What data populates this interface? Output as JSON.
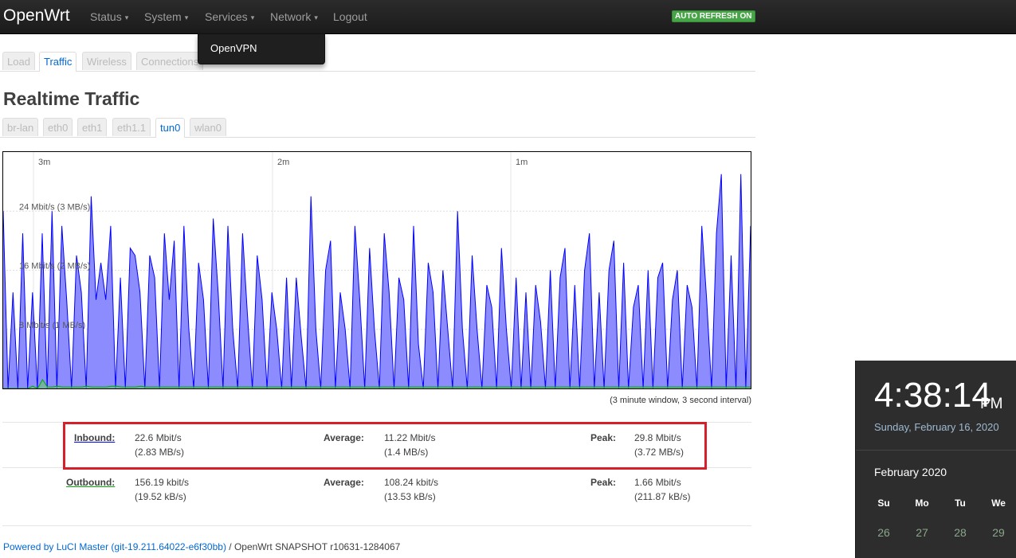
{
  "navbar": {
    "brand": "OpenWrt",
    "menu": [
      "Status",
      "System",
      "Services",
      "Network",
      "Logout"
    ],
    "auto_refresh": "AUTO REFRESH ON",
    "dropdown_item": "OpenVPN"
  },
  "tabs": [
    "Load",
    "Traffic",
    "Wireless",
    "Connections"
  ],
  "active_tab": "Traffic",
  "page_title": "Realtime Traffic",
  "interfaces": [
    "br-lan",
    "eth0",
    "eth1",
    "eth1.1",
    "tun0",
    "wlan0"
  ],
  "active_interface": "tun0",
  "graph": {
    "time_labels": [
      "3m",
      "2m",
      "1m"
    ],
    "y_labels": [
      "24 Mbit/s (3 MB/s)",
      "16 Mbit/s (2 MB/s)",
      "8 Mbit/s (1 MB/s)"
    ],
    "caption": "(3 minute window, 3 second interval)",
    "inbound_color": "#0000ff",
    "inbound_fill": "#8c8cff",
    "outbound_color": "#00aa00"
  },
  "chart_data": {
    "type": "area",
    "y_unit": "Mbit/s",
    "ylim": [
      0,
      32
    ],
    "inbound": [
      24,
      0,
      13,
      0,
      21,
      0,
      13,
      0,
      21,
      0,
      24,
      0,
      22,
      12,
      0,
      18,
      13,
      0,
      26,
      12,
      17,
      12,
      22,
      0,
      15,
      0,
      19,
      18,
      13,
      0,
      18,
      15,
      0,
      21,
      12,
      20,
      0,
      22,
      8,
      0,
      17,
      12,
      0,
      23,
      13,
      0,
      22,
      8,
      0,
      21,
      10,
      0,
      18,
      12,
      0,
      13,
      8,
      0,
      15,
      0,
      15,
      7,
      0,
      26,
      8,
      0,
      16,
      20,
      0,
      13,
      8,
      0,
      22,
      12,
      0,
      19,
      8,
      0,
      21,
      13,
      0,
      15,
      12,
      0,
      22,
      6,
      0,
      17,
      13,
      0,
      16,
      8,
      0,
      24,
      8,
      0,
      18,
      8,
      0,
      14,
      11,
      0,
      19,
      8,
      0,
      15,
      0,
      13,
      0,
      14,
      9,
      0,
      16,
      0,
      15,
      19,
      0,
      14,
      0,
      16,
      21,
      0,
      13,
      0,
      16,
      20,
      0,
      17,
      0,
      11,
      14,
      0,
      16,
      0,
      15,
      17,
      0,
      12,
      16,
      0,
      14,
      11,
      0,
      22,
      12,
      0,
      21,
      29,
      0,
      18,
      0,
      29,
      0,
      22
    ],
    "outbound": [
      0,
      0,
      0,
      0,
      0,
      0,
      0.3,
      0,
      1.2,
      0.2,
      0.2,
      0.3,
      0.2,
      0.2,
      0.2,
      0.2,
      0.2,
      0.3,
      0.2,
      0.2,
      0.2,
      0.2,
      0.3,
      0.3,
      0.2,
      0.2,
      0.2,
      0.2,
      0.3,
      0.2,
      0.2,
      0.2,
      0.2,
      0.2,
      0.2,
      0.2,
      0.2,
      0.2,
      0.2,
      0.2,
      0.2,
      0.2,
      0.2,
      0.2,
      0.2,
      0.2,
      0.2,
      0.2,
      0.2,
      0.2,
      0.2,
      0.2,
      0.2,
      0.2,
      0.2,
      0.2,
      0.2,
      0.2,
      0.2,
      0.2,
      0.2,
      0.2,
      0.2,
      0.2,
      0.2,
      0.2,
      0.2,
      0.2,
      0.2,
      0.2,
      0.2,
      0.2,
      0.2,
      0.2,
      0.2,
      0.2,
      0.2,
      0.2,
      0.2,
      0.2,
      0.2,
      0.2,
      0.2,
      0.2,
      0.2,
      0.2,
      0.2,
      0.2,
      0.2,
      0.2,
      0.2,
      0.2,
      0.2,
      0.2,
      0.2,
      0.2,
      0.2,
      0.2,
      0.2,
      0.2,
      0.2,
      0.2,
      0.2,
      0.2,
      0.2,
      0.2,
      0.2,
      0.2,
      0.2,
      0.2,
      0.2,
      0.2,
      0.2,
      0.2,
      0.2,
      0.2,
      0.2,
      0.2,
      0.2,
      0.2,
      0.2,
      0.2,
      0.2,
      0.2,
      0.2,
      0.2,
      0.2,
      0.2,
      0.2,
      0.2,
      0.2,
      0.2,
      0.2,
      0.2,
      0.2,
      0.2,
      0.2,
      0.2,
      0.2,
      0.2,
      0.2,
      0.2,
      0.2,
      0.2,
      0.2,
      0.2,
      0.2,
      0.2,
      0.2,
      0.2,
      0.2,
      0.2,
      0.2
    ]
  },
  "stats": {
    "inbound": {
      "label": "Inbound:",
      "current": "22.6 Mbit/s",
      "current_b": "(2.83 MB/s)",
      "avg_label": "Average:",
      "avg": "11.22 Mbit/s",
      "avg_b": "(1.4 MB/s)",
      "peak_label": "Peak:",
      "peak": "29.8 Mbit/s",
      "peak_b": "(3.72 MB/s)"
    },
    "outbound": {
      "label": "Outbound:",
      "current": "156.19 kbit/s",
      "current_b": "(19.52 kB/s)",
      "avg_label": "Average:",
      "avg": "108.24 kbit/s",
      "avg_b": "(13.53 kB/s)",
      "peak_label": "Peak:",
      "peak": "1.66 Mbit/s",
      "peak_b": "(211.87 kB/s)"
    }
  },
  "footer": {
    "link": "Powered by LuCI Master (git-19.211.64022-e6f30bb)",
    "rest": " / OpenWrt SNAPSHOT r10631-1284067"
  },
  "clock": {
    "time": "4:38:14",
    "ampm": "PM",
    "date": "Sunday, February 16, 2020",
    "month": "February 2020",
    "days_of_week": [
      "Su",
      "Mo",
      "Tu",
      "We"
    ],
    "days": [
      "26",
      "27",
      "28",
      "29"
    ]
  }
}
